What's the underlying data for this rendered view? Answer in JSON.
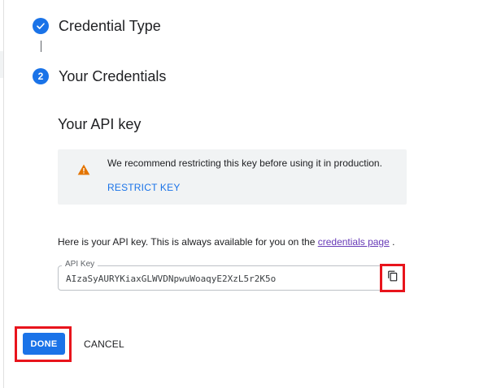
{
  "steps": [
    {
      "title": "Credential Type",
      "status": "complete",
      "icon": "check-icon"
    },
    {
      "title": "Your Credentials",
      "number": "2",
      "status": "active"
    }
  ],
  "section": {
    "title": "Your API key"
  },
  "warning": {
    "icon": "warning-icon",
    "message": "We recommend restricting this key before using it in production.",
    "link_label": "RESTRICT KEY"
  },
  "info": {
    "text": "Here is your API key. This is always available for you on the ",
    "link_label": "credentials page",
    "suffix": " ."
  },
  "api_key": {
    "label": "API Key",
    "value": "AIzaSyAURYKiaxGLWVDNpwuWoaqyE2XzL5r2K5o",
    "copy_icon": "copy-icon"
  },
  "actions": {
    "done_label": "DONE",
    "cancel_label": "CANCEL"
  },
  "colors": {
    "primary": "#1a73e8",
    "warning": "#e37400",
    "highlight": "#e8141c",
    "panel": "#f1f3f4",
    "link_visited": "#673ab7"
  }
}
